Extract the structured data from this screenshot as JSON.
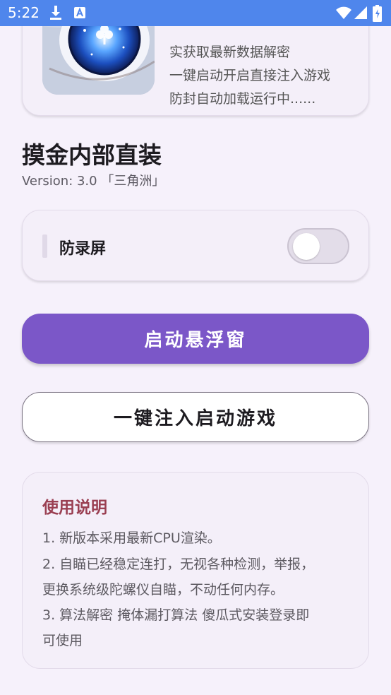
{
  "status_bar": {
    "time": "5:22",
    "icons": [
      "download-icon",
      "translate-icon",
      "wifi-icon",
      "signal-icon",
      "battery-icon"
    ]
  },
  "promo": {
    "lines": [
      "实获取最新数据解密",
      "一键启动开启直接注入游戏",
      "防封自动加载运行中......"
    ]
  },
  "header": {
    "title": "摸金内部直装",
    "version": "Version: 3.0 「三角洲」"
  },
  "toggle": {
    "label": "防录屏",
    "enabled": false
  },
  "buttons": {
    "primary": "启动悬浮窗",
    "secondary": "一键注入启动游戏"
  },
  "help": {
    "title": "使用说明",
    "lines": [
      "1. 新版本采用最新CPU渲染。",
      "2. 自瞄已经稳定连打，无视各种检测，举报，",
      "更换系统级陀螺仪自瞄，不动任何内存。",
      "3. 算法解密 掩体漏打算法 傻瓜式安装登录即",
      "可使用"
    ]
  },
  "colors": {
    "status_bar": "#4f86ec",
    "primary_button": "#7b57c8",
    "help_title": "#9a3f52",
    "background": "#f6f1fb"
  }
}
